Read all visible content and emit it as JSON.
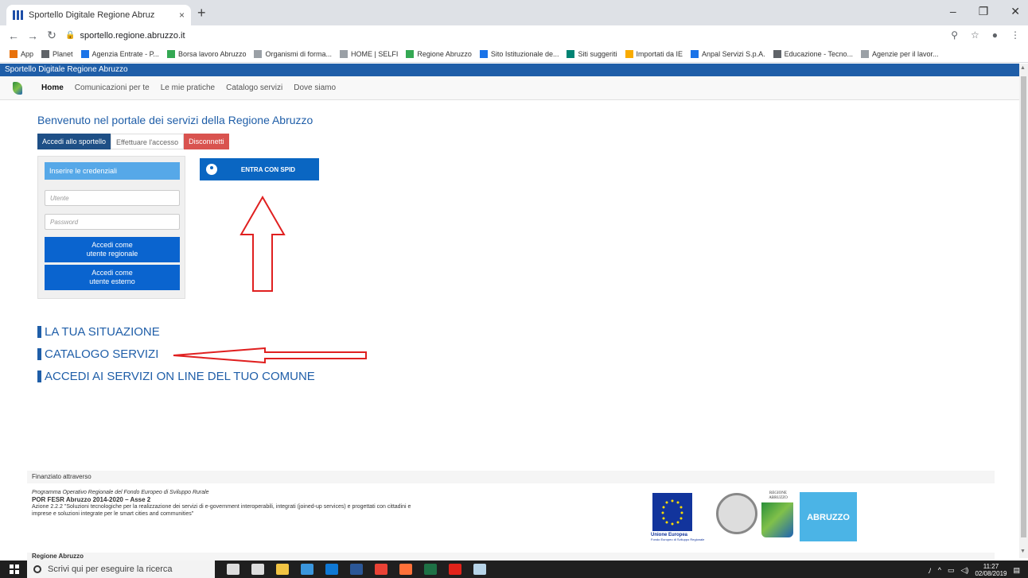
{
  "browser": {
    "tab_title": "Sportello Digitale Regione Abruz",
    "tab_close": "×",
    "new_tab": "+",
    "url": "sportello.regione.abruzzo.it",
    "window_controls": [
      "–",
      "❐",
      "✕"
    ],
    "bookmarks": [
      {
        "label": "App",
        "icon": "apps-grid-icon",
        "color": "#e8710a"
      },
      {
        "label": "Planet",
        "icon": "globe-icon",
        "color": "#5f6368"
      },
      {
        "label": "Agenzia Entrate - P...",
        "icon": "agenzia-icon",
        "color": "#1a73e8"
      },
      {
        "label": "Borsa lavoro Abruzzo",
        "icon": "leaf-icon",
        "color": "#34a853"
      },
      {
        "label": "Organismi di forma...",
        "icon": "page-icon",
        "color": "#9aa0a6"
      },
      {
        "label": "HOME | SELFI",
        "icon": "page-icon",
        "color": "#9aa0a6"
      },
      {
        "label": "Regione Abruzzo",
        "icon": "leaf-icon",
        "color": "#34a853"
      },
      {
        "label": "Sito Istituzionale de...",
        "icon": "site-icon",
        "color": "#1a73e8"
      },
      {
        "label": "Siti suggeriti",
        "icon": "bing-icon",
        "color": "#008373"
      },
      {
        "label": "Importati da IE",
        "icon": "folder-icon",
        "color": "#f9ab00"
      },
      {
        "label": "Anpal Servizi S.p.A.",
        "icon": "anpal-icon",
        "color": "#1a73e8"
      },
      {
        "label": "Educazione - Tecno...",
        "icon": "globe-icon",
        "color": "#5f6368"
      },
      {
        "label": "Agenzie per il lavor...",
        "icon": "page-icon",
        "color": "#9aa0a6"
      }
    ]
  },
  "site": {
    "top_title": "Sportello Digitale Regione Abruzzo",
    "nav": [
      "Home",
      "Comunicazioni per te",
      "Le mie pratiche",
      "Catalogo servizi",
      "Dove siamo"
    ],
    "welcome": "Benvenuto nel portale dei servizi della Regione Abruzzo",
    "tabs": {
      "accedi": "Accedi allo sportello",
      "effettuare": "Effettuare l'accesso",
      "disconnetti": "Disconnetti"
    },
    "login": {
      "heading": "Inserire le credenziali",
      "user_placeholder": "Utente",
      "password_placeholder": "Password",
      "btn_regionale_1": "Accedi come",
      "btn_regionale_2": "utente regionale",
      "btn_esterno_1": "Accedi come",
      "btn_esterno_2": "utente esterno"
    },
    "spid_label": "ENTRA CON SPID",
    "links": [
      "LA TUA SITUAZIONE",
      "CATALOGO SERVIZI",
      "ACCEDI AI SERVIZI ON LINE DEL TUO COMUNE"
    ],
    "footer": {
      "finanziato": "Finanziato attraverso",
      "programma": "Programma Operativo Regionale del Fondo Europeo di Sviluppo Rurale",
      "por": "POR FESR Abruzzo 2014-2020 – Asse 2",
      "azione_1": "Azione 2.2.2 \"Soluzioni tecnologiche per la realizzazione dei servizi di e-government interoperabili, integrati (joined-up services) e progettati con cittadini e",
      "azione_2": "imprese e soluzioni integrate per le smart cities and communities\"",
      "regione": "Regione Abruzzo",
      "eu_title": "Unione Europea",
      "eu_sub": "Fondo Europeo di Sviluppo Regionale",
      "regione_logo_1": "REGIONE",
      "regione_logo_2": "ABRUZZO",
      "abruzzo_logo": "ABRUZZO"
    }
  },
  "taskbar": {
    "search_placeholder": "Scrivi qui per eseguire la ricerca",
    "time": "11:27",
    "date": "02/08/2019",
    "apps": [
      {
        "name": "cortana-mic-icon",
        "color": "#ddd"
      },
      {
        "name": "task-view-icon",
        "color": "#ddd"
      },
      {
        "name": "file-explorer-icon",
        "color": "#f2c443"
      },
      {
        "name": "edge-icon",
        "color": "#3a96dd"
      },
      {
        "name": "outlook-icon",
        "color": "#0f78d4"
      },
      {
        "name": "word-icon",
        "color": "#2b5797"
      },
      {
        "name": "chrome-icon",
        "color": "#e94235"
      },
      {
        "name": "firefox-icon",
        "color": "#ff7139"
      },
      {
        "name": "excel-icon",
        "color": "#1e7145"
      },
      {
        "name": "acrobat-icon",
        "color": "#e2231a"
      },
      {
        "name": "paint-icon",
        "color": "#b7d4e8"
      }
    ]
  },
  "annotations_color": "#e02020"
}
